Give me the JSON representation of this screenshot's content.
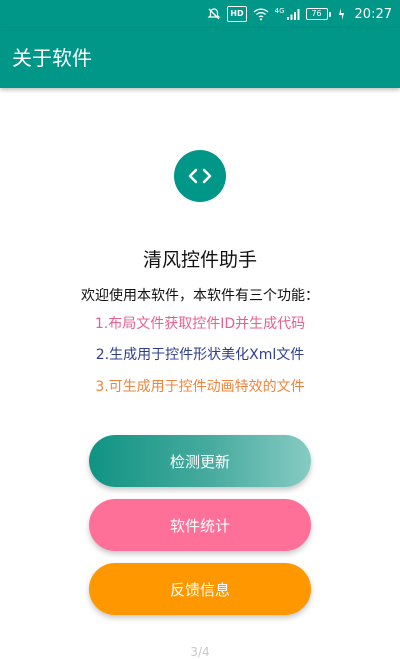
{
  "status_bar": {
    "hd_label": "HD",
    "signal_label": "4G",
    "battery_level": "76",
    "time": "20:27",
    "icons": [
      "mute-icon",
      "hd-icon",
      "wifi-icon",
      "signal-icon",
      "battery-icon",
      "charging-icon"
    ]
  },
  "appbar": {
    "title": "关于软件"
  },
  "about": {
    "logo_icon": "code-brackets-icon",
    "app_name": "清风控件助手",
    "welcome": "欢迎使用本软件，本软件有三个功能：",
    "features": [
      "1.布局文件获取控件ID并生成代码",
      "2.生成用于控件形状美化Xml文件",
      "3.可生成用于控件动画特效的文件"
    ]
  },
  "buttons": {
    "update": "检测更新",
    "stats": "软件统计",
    "feedback": "反馈信息"
  },
  "pager": {
    "label": "3/4"
  },
  "colors": {
    "primary": "#009688",
    "feature1": "#e9608c",
    "feature2": "#2f3f8f",
    "feature3": "#f0843c",
    "stats_button": "#ff7099",
    "feedback_button": "#ff9800"
  }
}
